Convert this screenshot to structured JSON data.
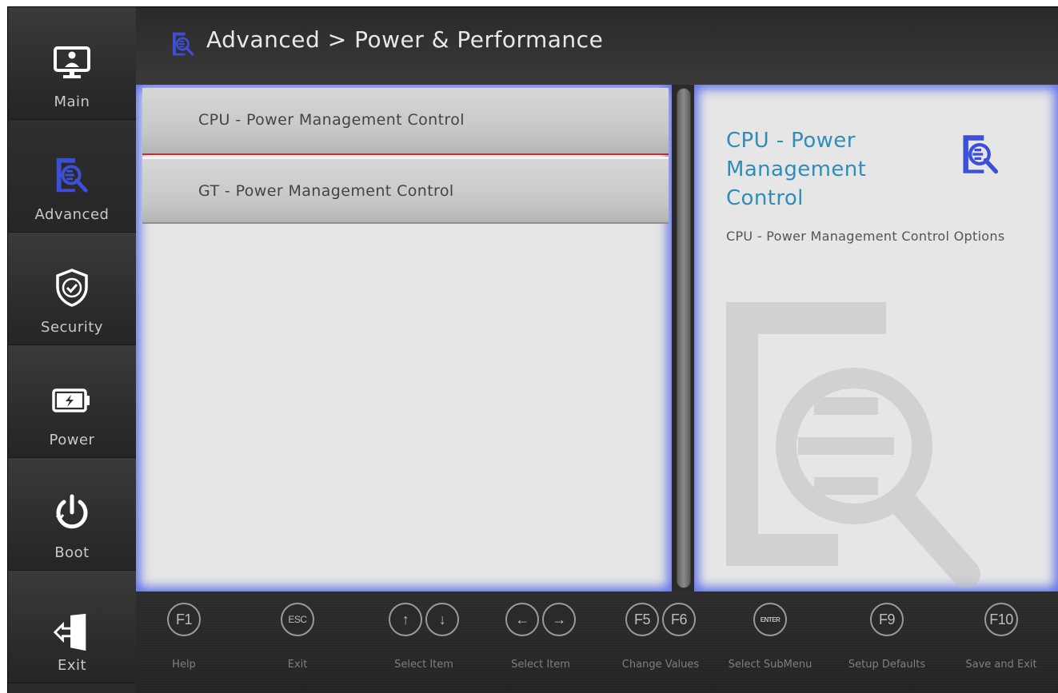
{
  "sidebar": {
    "items": [
      {
        "label": "Main",
        "icon": "monitor-user-icon"
      },
      {
        "label": "Advanced",
        "icon": "document-search-icon"
      },
      {
        "label": "Security",
        "icon": "shield-check-icon"
      },
      {
        "label": "Power",
        "icon": "battery-icon"
      },
      {
        "label": "Boot",
        "icon": "power-icon"
      },
      {
        "label": "Exit",
        "icon": "exit-door-icon"
      }
    ],
    "active": "Advanced"
  },
  "header": {
    "breadcrumb": "Advanced > Power & Performance",
    "icon": "document-search-icon"
  },
  "menu": {
    "items": [
      {
        "label": "CPU - Power Management Control",
        "selected": true
      },
      {
        "label": "GT - Power Management Control",
        "selected": false
      }
    ]
  },
  "help": {
    "title": "CPU - Power Management Control",
    "description": "CPU - Power Management Control Options",
    "icon": "document-search-icon"
  },
  "footer": {
    "keys": [
      {
        "keys": [
          "F1"
        ],
        "label": "Help"
      },
      {
        "keys": [
          "ESC"
        ],
        "label": "Exit"
      },
      {
        "keys": [
          "↑",
          "↓"
        ],
        "label": "Select Item"
      },
      {
        "keys": [
          "←",
          "→"
        ],
        "label": "Select Item"
      },
      {
        "keys": [
          "F5",
          "F6"
        ],
        "label": "Change Values"
      },
      {
        "keys": [
          "ENTER"
        ],
        "label": "Select  SubMenu"
      },
      {
        "keys": [
          "F9"
        ],
        "label": "Setup Defaults"
      },
      {
        "keys": [
          "F10"
        ],
        "label": "Save and Exit"
      }
    ]
  },
  "colors": {
    "accent_blue": "#2e8eb8",
    "icon_blue": "#3b4fd8",
    "panel_glow": "#5d6ee8",
    "selection_line": "#b83434"
  }
}
